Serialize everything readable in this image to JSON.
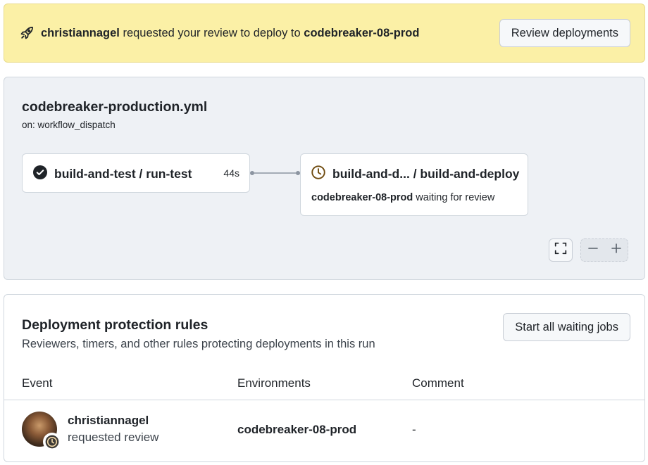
{
  "banner": {
    "user": "christiannagel",
    "text": " requested your review to deploy to ",
    "environment": "codebreaker-08-prod",
    "button_label": "Review deployments"
  },
  "workflow": {
    "file": "codebreaker-production.yml",
    "trigger": "on: workflow_dispatch",
    "jobs": [
      {
        "name": "build-and-test / run-test",
        "status": "success",
        "duration": "44s"
      },
      {
        "name": "build-and-d... / build-and-deploy",
        "status": "waiting",
        "environment": "codebreaker-08-prod",
        "status_text": " waiting for review"
      }
    ]
  },
  "protection": {
    "title": "Deployment protection rules",
    "description": "Reviewers, timers, and other rules protecting deployments in this run",
    "button_label": "Start all waiting jobs",
    "columns": [
      "Event",
      "Environments",
      "Comment"
    ],
    "rows": [
      {
        "user": "christiannagel",
        "action": "requested review",
        "environment": "codebreaker-08-prod",
        "comment": "-"
      }
    ]
  },
  "icons": {
    "banner": "rocket-icon",
    "job_success": "check-circle-fill-icon",
    "job_waiting": "clock-icon",
    "fullscreen": "screen-full-icon",
    "zoom_out": "dash-icon",
    "zoom_in": "plus-icon"
  },
  "colors": {
    "banner_bg": "#fbf0a6",
    "graph_bg": "#eef1f5",
    "border": "#d0d7de",
    "connector": "#8c95a1"
  }
}
